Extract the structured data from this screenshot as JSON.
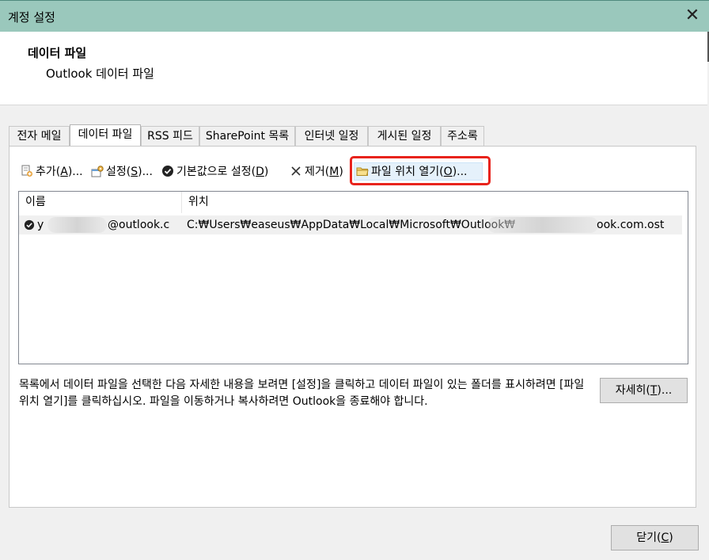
{
  "window": {
    "title": "계정 설정",
    "close_glyph": "✕"
  },
  "header": {
    "title": "데이터 파일",
    "subtitle": "Outlook 데이터 파일"
  },
  "tabs": [
    {
      "label": "전자 메일"
    },
    {
      "label": "데이터 파일",
      "active": true
    },
    {
      "label": "RSS 피드"
    },
    {
      "label": "SharePoint 목록"
    },
    {
      "label": "인터넷 일정"
    },
    {
      "label": "게시된 일정"
    },
    {
      "label": "주소록"
    }
  ],
  "toolbar": {
    "add": {
      "text": "추가(",
      "key": "A",
      "tail": ")...",
      "icon": "add-data-file-icon"
    },
    "settings": {
      "text": "설정(",
      "key": "S",
      "tail": ")...",
      "icon": "settings-icon"
    },
    "default": {
      "text": "기본값으로 설정(",
      "key": "D",
      "tail": ")",
      "icon": "check-circle-icon"
    },
    "remove": {
      "text": "제거(",
      "key": "M",
      "tail": ")",
      "icon": "x-icon"
    },
    "open_location": {
      "text": "파일 위치 열기(",
      "key": "O",
      "tail": ")...",
      "icon": "folder-icon"
    }
  },
  "list": {
    "columns": [
      "이름",
      "위치"
    ],
    "rows": [
      {
        "name_start": "y",
        "name_end": "@outlook.c",
        "location_start": "C:₩Users₩easeus₩AppData₩Local₩Microsoft₩Outlook₩",
        "location_end": "ook.com.ost",
        "is_default": true
      }
    ]
  },
  "description": "목록에서 데이터 파일을 선택한 다음 자세한 내용을 보려면 [설정]을 클릭하고 데이터 파일이 있는 폴더를 표시하려면 [파일 위치 열기]를 클릭하십시오. 파일을 이동하거나 복사하려면 Outlook을 종료해야 합니다.",
  "buttons": {
    "details": {
      "text": "자세히(",
      "key": "T",
      "tail": ")..."
    },
    "close": {
      "text": "닫기(",
      "key": "C",
      "tail": ")"
    }
  },
  "colors": {
    "titlebar": "#9ac8bc",
    "highlight": "#e8231c"
  }
}
